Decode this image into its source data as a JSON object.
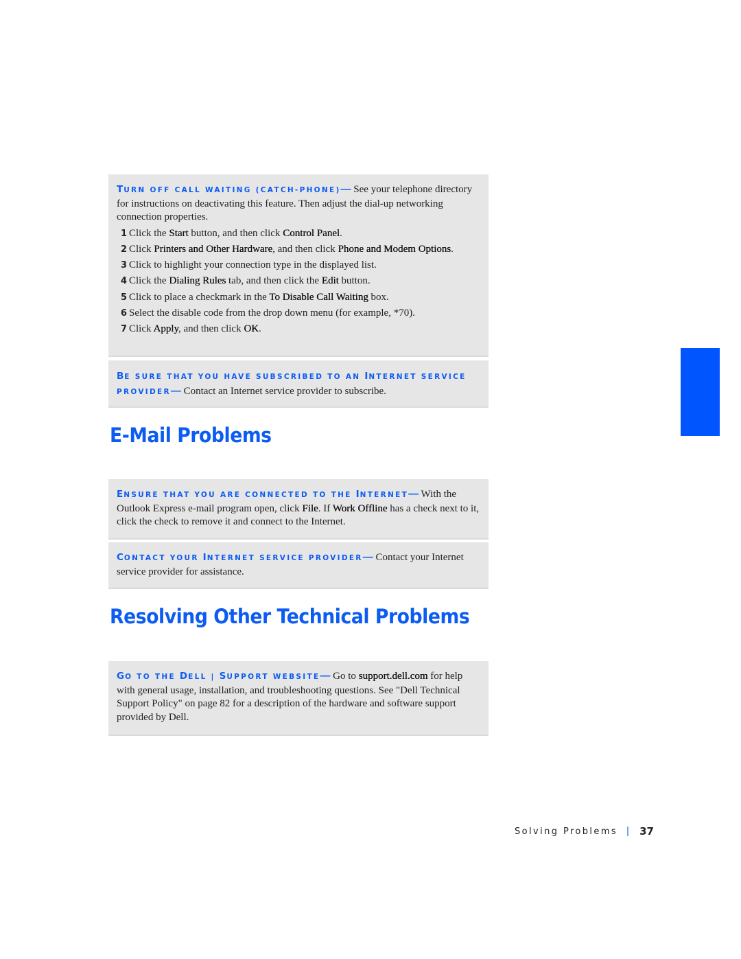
{
  "boxes": {
    "call_waiting": {
      "lead_cap": "T",
      "lead_rest": "urn off call waiting (catch-phone)",
      "dash": "—",
      "text": "See your telephone directory for instructions on deactivating this feature. Then adjust the dial-up networking connection properties.",
      "steps": [
        {
          "num": "1",
          "parts": [
            "Click the ",
            "Start",
            " button, and then click ",
            "Control Panel",
            "."
          ]
        },
        {
          "num": "2",
          "parts": [
            "Click ",
            "Printers and Other Hardware",
            ", and then click ",
            "Phone and Modem Options",
            "."
          ]
        },
        {
          "num": "3",
          "parts": [
            "Click to highlight your connection type in the displayed list.",
            "",
            "",
            "",
            ""
          ]
        },
        {
          "num": "4",
          "parts": [
            "Click the ",
            "Dialing Rules",
            " tab, and then click the ",
            "Edit",
            " button."
          ]
        },
        {
          "num": "5",
          "parts": [
            "Click to place a checkmark in the ",
            "To Disable Call Waiting",
            " box.",
            "",
            ""
          ]
        },
        {
          "num": "6",
          "parts": [
            "Select the disable code from the drop down menu (for example, *70).",
            "",
            "",
            "",
            ""
          ]
        },
        {
          "num": "7",
          "parts": [
            "Click ",
            "Apply",
            ", and then click ",
            "OK",
            "."
          ]
        }
      ]
    },
    "subscribed": {
      "lead_cap": "B",
      "lead_rest": "e sure that you have subscribed to an ",
      "lead_cap2": "I",
      "lead_rest2": "nternet service provider",
      "dash": "—",
      "text": "Contact an Internet service provider to subscribe."
    },
    "connected": {
      "lead_cap": "E",
      "lead_rest": "nsure that you are connected to the ",
      "lead_cap2": "I",
      "lead_rest2": "nternet",
      "dash": "—",
      "text_parts": [
        "With the Outlook Express e-mail program open, click ",
        "File",
        ". If ",
        "Work Offline",
        " has a check next to it, click the check to remove it and connect to the Internet."
      ]
    },
    "contact_isp": {
      "lead_cap": "C",
      "lead_rest": "ontact your ",
      "lead_cap2": "I",
      "lead_rest2": "nternet service provider",
      "dash": "—",
      "text": "Contact your Internet service provider for assistance."
    },
    "dell_support": {
      "lead_cap": "G",
      "lead_rest": "o to the ",
      "lead_cap2": "D",
      "lead_rest2": "ell | ",
      "lead_cap3": "S",
      "lead_rest3": "upport website",
      "dash": "—",
      "text_parts": [
        "Go to ",
        "support.dell.com",
        " for help with general usage, installation, and troubleshooting questions. See \"Dell Technical Support Policy\" on page 82 for a description of the hardware and software support provided by Dell."
      ]
    }
  },
  "headings": {
    "email": "E-Mail Problems",
    "other": "Resolving Other Technical Problems"
  },
  "footer": {
    "section": "Solving Problems",
    "page": "37"
  },
  "colors": {
    "accent": "#0d5cf2",
    "side_tab": "#0055ff",
    "box_bg": "#e6e6e6"
  }
}
